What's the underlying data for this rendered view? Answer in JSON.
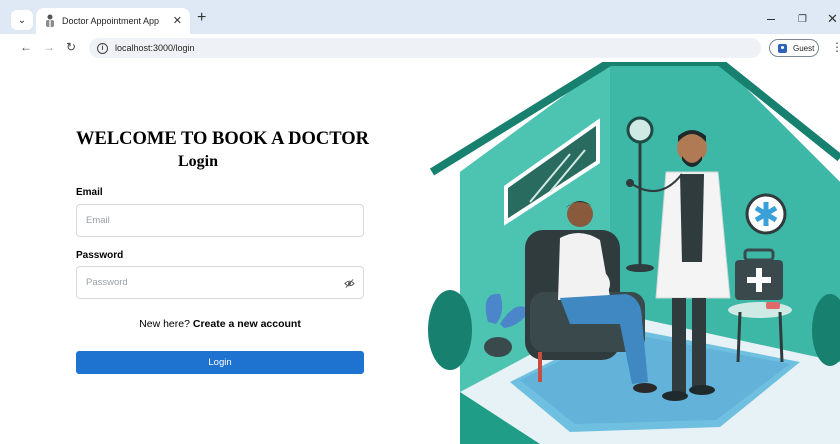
{
  "browser": {
    "tab_title": "Doctor Appointment App",
    "url": "localhost:3000/login",
    "profile_label": "Guest"
  },
  "page": {
    "heading": "WELCOME TO BOOK A DOCTOR",
    "subheading": "Login",
    "email_label": "Email",
    "email_placeholder": "Email",
    "password_label": "Password",
    "password_placeholder": "Password",
    "signup_prompt": "New here?",
    "signup_link": "Create a new account",
    "login_button": "Login"
  },
  "colors": {
    "accent": "#1f73d0",
    "teal": "#3db8a6",
    "tab_bar": "#dfe9f6"
  }
}
